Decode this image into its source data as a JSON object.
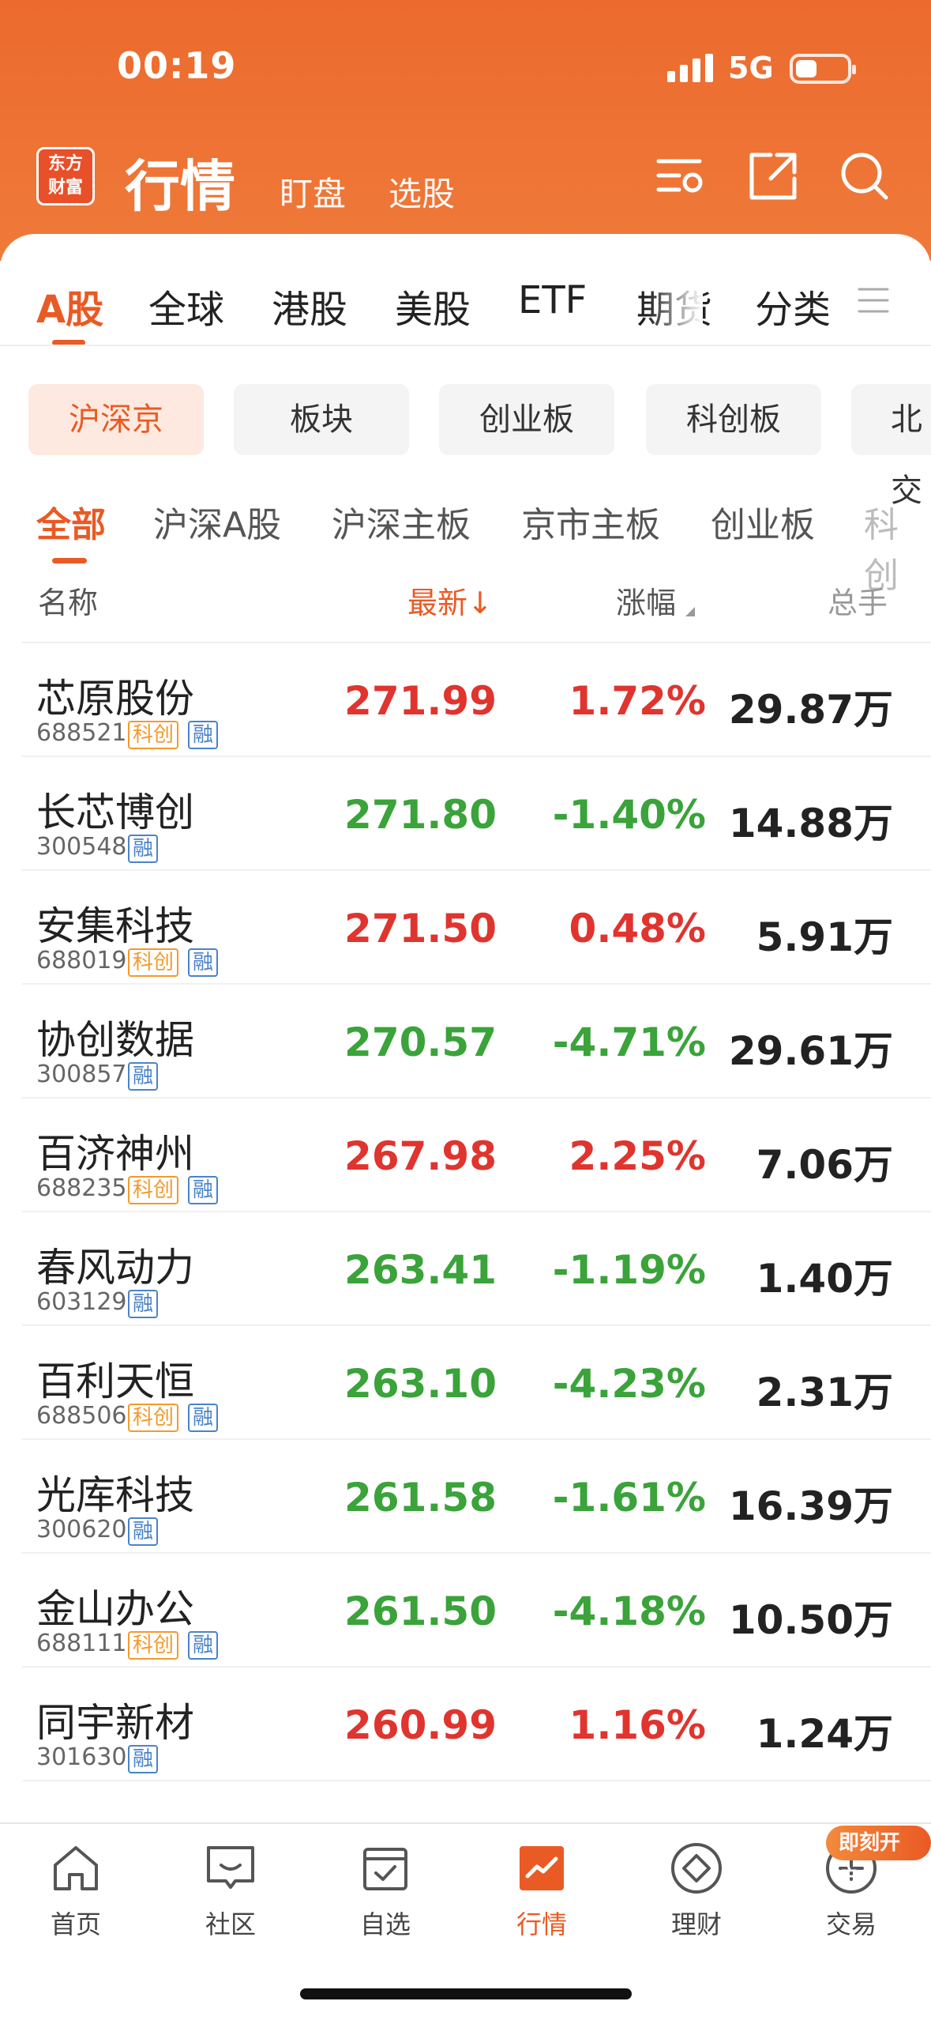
{
  "status_bar": {
    "time": "00:19",
    "network": "5G"
  },
  "header": {
    "logo_line1": "东方",
    "logo_line2": "财富",
    "title": "行情",
    "subtabs": [
      "盯盘",
      "选股"
    ]
  },
  "main_tabs": [
    "A股",
    "全球",
    "港股",
    "美股",
    "ETF",
    "期货",
    "分类"
  ],
  "market_chips": [
    "沪深京",
    "板块",
    "创业板",
    "科创板",
    "北交"
  ],
  "sub_tabs": [
    "全部",
    "沪深A股",
    "沪深主板",
    "京市主板",
    "创业板",
    "科创"
  ],
  "columns": {
    "name": "名称",
    "latest": "最新↓",
    "change": "涨幅",
    "volume": "总手"
  },
  "badges": {
    "kc": "科创",
    "rong": "融"
  },
  "stocks": [
    {
      "name": "芯原股份",
      "code": "688521",
      "kc": true,
      "price": "271.99",
      "change": "1.72%",
      "volume": "29.87万",
      "trend": "up"
    },
    {
      "name": "长芯博创",
      "code": "300548",
      "kc": false,
      "price": "271.80",
      "change": "-1.40%",
      "volume": "14.88万",
      "trend": "down"
    },
    {
      "name": "安集科技",
      "code": "688019",
      "kc": true,
      "price": "271.50",
      "change": "0.48%",
      "volume": "5.91万",
      "trend": "up"
    },
    {
      "name": "协创数据",
      "code": "300857",
      "kc": false,
      "price": "270.57",
      "change": "-4.71%",
      "volume": "29.61万",
      "trend": "down"
    },
    {
      "name": "百济神州",
      "code": "688235",
      "kc": true,
      "price": "267.98",
      "change": "2.25%",
      "volume": "7.06万",
      "trend": "up"
    },
    {
      "name": "春风动力",
      "code": "603129",
      "kc": false,
      "price": "263.41",
      "change": "-1.19%",
      "volume": "1.40万",
      "trend": "down"
    },
    {
      "name": "百利天恒",
      "code": "688506",
      "kc": true,
      "price": "263.10",
      "change": "-4.23%",
      "volume": "2.31万",
      "trend": "down"
    },
    {
      "name": "光库科技",
      "code": "300620",
      "kc": false,
      "price": "261.58",
      "change": "-1.61%",
      "volume": "16.39万",
      "trend": "down"
    },
    {
      "name": "金山办公",
      "code": "688111",
      "kc": true,
      "price": "261.50",
      "change": "-4.18%",
      "volume": "10.50万",
      "trend": "down"
    },
    {
      "name": "同宇新材",
      "code": "301630",
      "kc": false,
      "price": "260.99",
      "change": "1.16%",
      "volume": "1.24万",
      "trend": "up"
    }
  ],
  "bottom_nav": [
    "首页",
    "社区",
    "自选",
    "行情",
    "理财",
    "交易"
  ],
  "promo_badge": "即刻开户",
  "colors": {
    "brand": "#ea5a24",
    "up": "#e0342f",
    "down": "#3aa33a",
    "kc_badge": "#f39a2c",
    "rong_badge": "#4a83c9"
  }
}
